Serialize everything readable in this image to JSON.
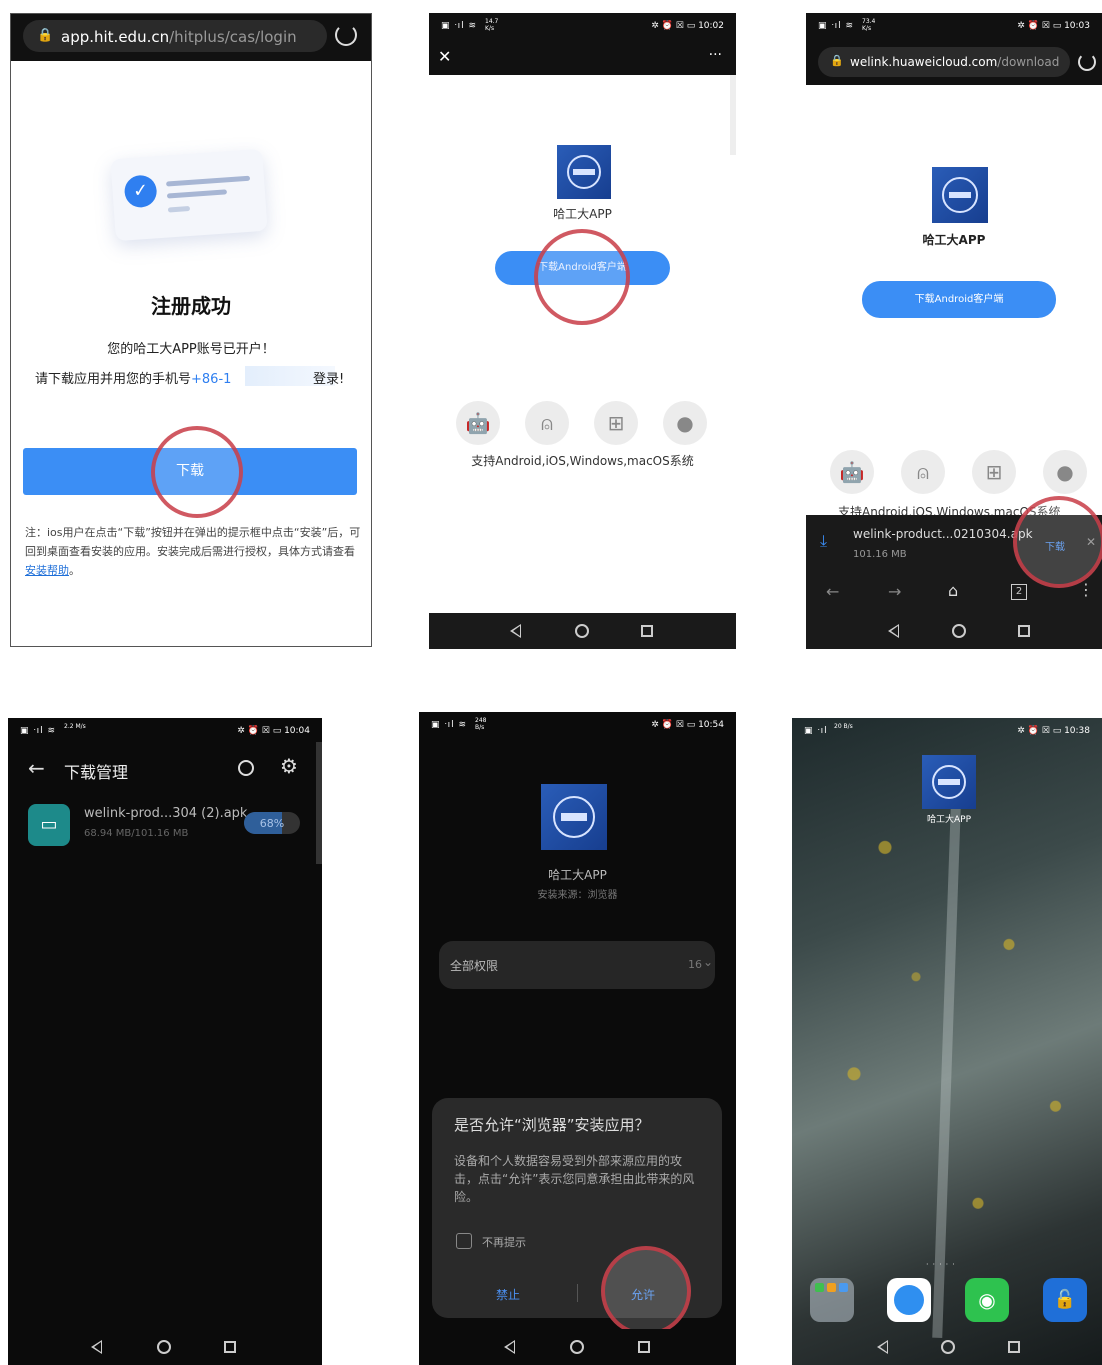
{
  "status": {
    "p2": {
      "time": "10:02",
      "speed": "14.7 K/s"
    },
    "p3": {
      "time": "10:03",
      "speed": "73.4 K/s"
    },
    "p4": {
      "time": "10:04",
      "speed": "2.2 M/s"
    },
    "p5": {
      "time": "10:54",
      "speed": "248 B/s"
    },
    "p6": {
      "time": "10:38",
      "speed": "20 B/s"
    }
  },
  "panel1": {
    "url_host": "app.hit.edu.cn",
    "url_path": "/hitplus/cas/login",
    "title": "注册成功",
    "line1": "您的哈工大APP账号已开户！",
    "line2_prefix": "请下载应用并用您的手机号",
    "line2_phone": "+86-1",
    "line2_suffix": "登录!",
    "download_btn": "下载",
    "note": "注：ios用户在点击“下载”按钮并在弹出的提示框中点击“安装”后，可回到桌面查看安装的应用。安装完成后需进行授权，具体方式请查看",
    "help_link": "安装帮助",
    "note_end": "。"
  },
  "panel2": {
    "app_name": "哈工大APP",
    "download_btn": "下载Android客户端",
    "support_text": "支持Android,iOS,Windows,macOS系统",
    "more": "···",
    "close": "✕"
  },
  "panel3": {
    "url_host": "welink.huaweicloud.com",
    "url_path": "/download",
    "app_name": "哈工大APP",
    "download_btn": "下载Android客户端",
    "support_text": "支持Android,iOS,Windows,macOS系统",
    "file_name": "welink-product...0210304.apk",
    "file_size": "101.16 MB",
    "download_action": "下载",
    "tab_count": "2"
  },
  "panel4": {
    "title": "下载管理",
    "file_name": "welink-prod...304 (2).apk",
    "progress_text": "68.94 MB/101.16 MB",
    "percent": "68%",
    "progress": 0.68
  },
  "panel5": {
    "app_name": "哈工大APP",
    "source": "安装来源：浏览器",
    "perm_label": "全部权限",
    "perm_count": "16",
    "dialog_title": "是否允许“浏览器”安装应用？",
    "dialog_body": "设备和个人数据容易受到外部来源应用的攻击，点击“允许”表示您同意承担由此带来的风险。",
    "checkbox_label": "不再提示",
    "deny": "禁止",
    "allow": "允许"
  },
  "panel6": {
    "app_name": "哈工大APP"
  },
  "colors": {
    "primary_blue": "#3b8ef5",
    "dark_bg": "#0b0b0b",
    "ring_red": "#c83c46",
    "link_blue": "#1f6fd8"
  }
}
